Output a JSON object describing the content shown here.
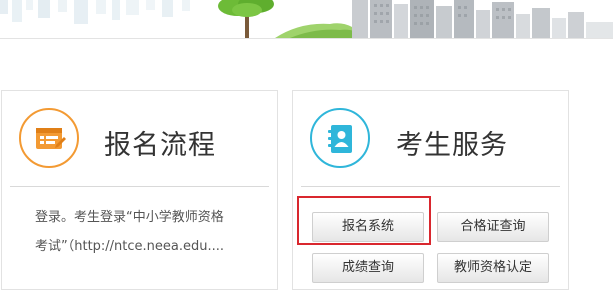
{
  "colors": {
    "process_accent": "#f39a33",
    "services_accent": "#2fb6da",
    "highlight": "#d9272e",
    "tree": "#5fae2e"
  },
  "process_panel": {
    "icon": "form-card-icon",
    "title": "报名流程",
    "text_lines": [
      "登录。考生登录“中小学教师资格",
      "考试”（http://ntce.neea.edu...."
    ]
  },
  "services_panel": {
    "icon": "address-book-icon",
    "title": "考生服务",
    "buttons": {
      "registration": "报名系统",
      "certificate": "合格证查询",
      "score": "成绩查询",
      "teacher_cert": "教师资格认定"
    }
  }
}
